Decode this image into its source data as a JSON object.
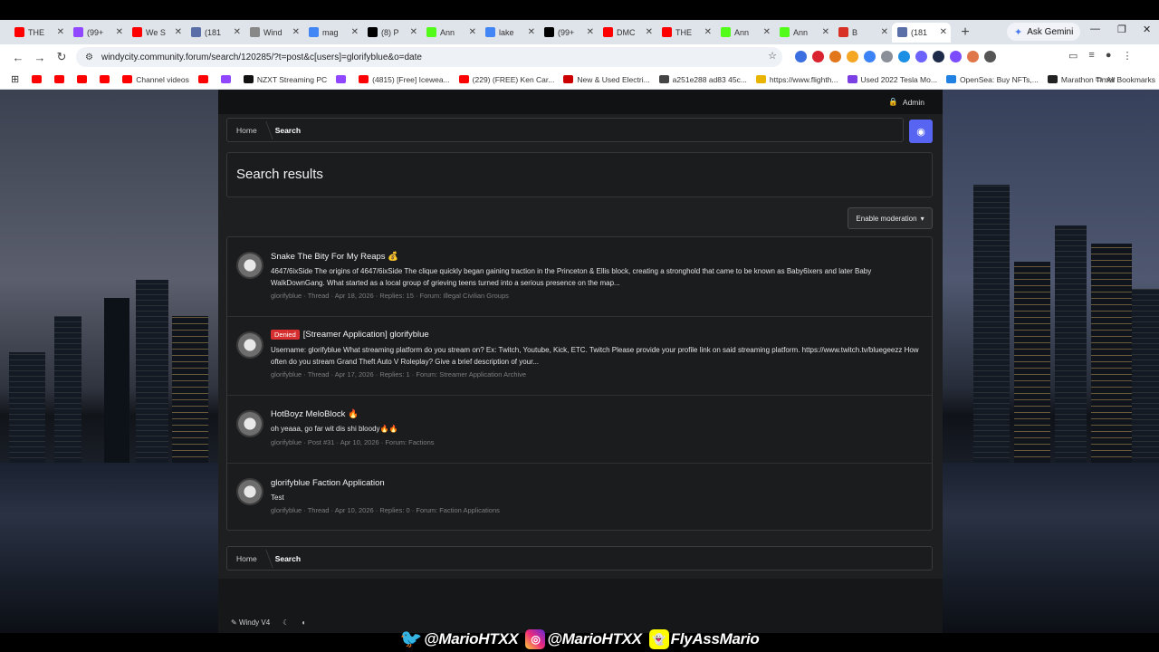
{
  "browser": {
    "tabs": [
      {
        "title": "THE",
        "color": "#ff0000"
      },
      {
        "title": "(99+",
        "color": "#9146ff"
      },
      {
        "title": "We S",
        "color": "#ff0000"
      },
      {
        "title": "(181",
        "color": "#5a6ea8"
      },
      {
        "title": "Wind",
        "color": "#888888"
      },
      {
        "title": "mag",
        "color": "#4285f4"
      },
      {
        "title": "(8) P",
        "color": "#000000"
      },
      {
        "title": "Ann",
        "color": "#53fc18"
      },
      {
        "title": "lake",
        "color": "#4285f4"
      },
      {
        "title": "(99+",
        "color": "#000000"
      },
      {
        "title": "DMC",
        "color": "#ff0000"
      },
      {
        "title": "THE",
        "color": "#ff0000"
      },
      {
        "title": "Ann",
        "color": "#53fc18"
      },
      {
        "title": "Ann",
        "color": "#53fc18"
      },
      {
        "title": "B",
        "color": "#d93025"
      },
      {
        "title": "(181",
        "color": "#5a6ea8",
        "active": true
      }
    ],
    "ask_gemini": "Ask Gemini",
    "url": "windycity.community.forum/search/120285/?t=post&c[users]=glorifyblue&o=date",
    "bookmarks": [
      {
        "label": "",
        "type": "yt"
      },
      {
        "label": "",
        "type": "yt"
      },
      {
        "label": "",
        "type": "yt"
      },
      {
        "label": "",
        "type": "yt"
      },
      {
        "label": "Channel videos",
        "type": "yt"
      },
      {
        "label": "",
        "type": "yt"
      },
      {
        "label": "",
        "type": "twitch"
      },
      {
        "label": "NZXT Streaming PC",
        "type": "nzxt"
      },
      {
        "label": "",
        "type": "twitch"
      },
      {
        "label": "(4815) [Free] Icewea...",
        "type": "yt"
      },
      {
        "label": "(229) (FREE) Ken Car...",
        "type": "yt"
      },
      {
        "label": "New & Used Electri...",
        "type": "tesla"
      },
      {
        "label": "a251e288 ad83 45c...",
        "type": "gh"
      },
      {
        "label": "https://www.flighth...",
        "type": "fl"
      },
      {
        "label": "Used 2022 Tesla Mo...",
        "type": "pp"
      },
      {
        "label": "OpenSea: Buy NFTs,...",
        "type": "os"
      },
      {
        "label": "Marathon Timer",
        "type": "mt"
      }
    ],
    "all_bookmarks": "All Bookmarks"
  },
  "forum": {
    "admin_label": "Admin",
    "breadcrumb": [
      "Home",
      "Search"
    ],
    "page_title": "Search results",
    "moderation_label": "Enable moderation",
    "results": [
      {
        "badge": "",
        "title": "Snake The Bity For My Reaps",
        "title_emoji": "💰",
        "snippet": "4647/6ixSide The origins of 4647/6ixSide The clique quickly began gaining traction in the Princeton & Ellis block, creating a stronghold that came to be known as Baby6ixers and later Baby WalkDownGang. What started as a local group of grieving teens turned into a serious presence on the map...",
        "meta": "glorifyblue · Thread · Apr 18, 2026 · Replies: 15 · Forum: Illegal Civilian Groups"
      },
      {
        "badge": "Denied",
        "title": "[Streamer Application] glorifyblue",
        "title_emoji": "",
        "snippet": "Username: glorifyblue What streaming platform do you stream on? Ex: Twitch, Youtube, Kick, ETC. Twitch Please provide your profile link on said streaming platform. https://www.twitch.tv/bluegeezz How often do you stream Grand Theft Auto V Roleplay? Give a brief description of your...",
        "meta": "glorifyblue · Thread · Apr 17, 2026 · Replies: 1 · Forum: Streamer Application Archive"
      },
      {
        "badge": "",
        "title": "HotBoyz MeloBlock",
        "title_emoji": "🔥",
        "snippet": "oh yeaaa, go far wit dis shi bloody🔥🔥",
        "meta": "glorifyblue · Post #31 · Apr 10, 2026 · Forum: Factions"
      },
      {
        "badge": "",
        "title": "glorifyblue Faction Application",
        "title_emoji": "",
        "snippet": "Test",
        "meta": "glorifyblue · Thread · Apr 10, 2026 · Replies: 0 · Forum: Faction Applications"
      }
    ],
    "footer_style": "Windy V4"
  },
  "overlay": {
    "twitter": "@MarioHTXX",
    "instagram": "@MarioHTXX",
    "snapchat": "FlyAssMario"
  }
}
